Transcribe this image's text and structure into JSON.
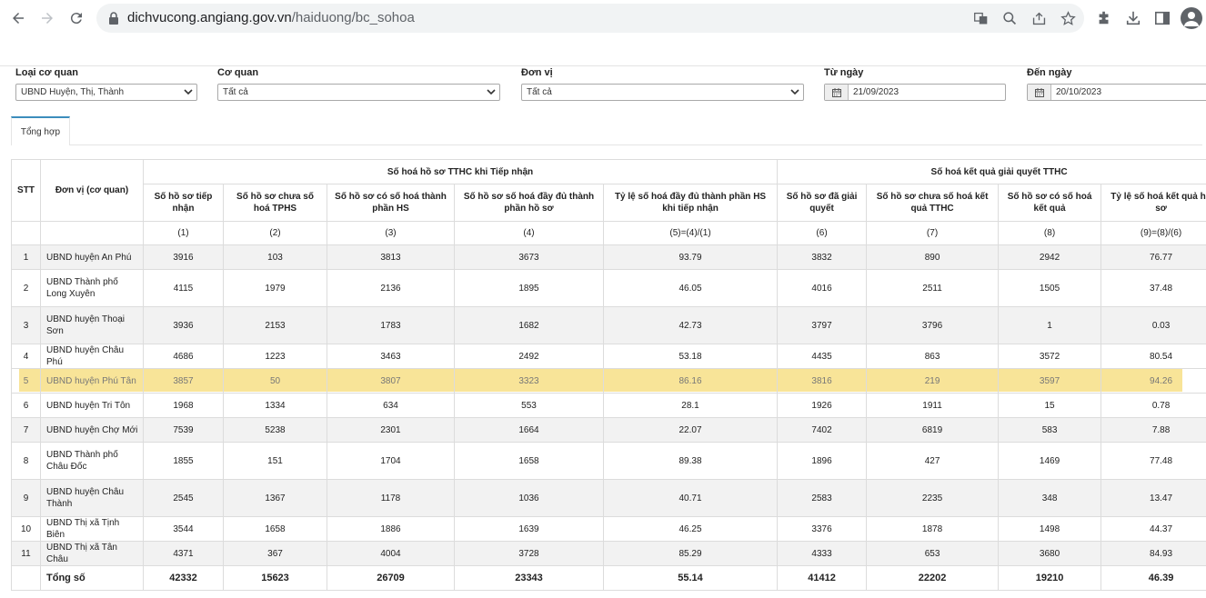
{
  "browser": {
    "url_host": "dichvucong.angiang.gov.vn",
    "url_path": "/haiduong/bc_sohoa"
  },
  "filters": {
    "loai_co_quan": {
      "label": "Loại cơ quan",
      "value": "UBND Huyện, Thị, Thành"
    },
    "co_quan": {
      "label": "Cơ quan",
      "value": "Tất cả"
    },
    "don_vi": {
      "label": "Đơn vị",
      "value": "Tất cả"
    },
    "tu_ngay": {
      "label": "Từ ngày",
      "value": "21/09/2023"
    },
    "den_ngay": {
      "label": "Đến ngày",
      "value": "20/10/2023"
    }
  },
  "tabs": [
    {
      "label": "Tổng hợp"
    }
  ],
  "table": {
    "head": {
      "stt": "STT",
      "unit": "Đơn vị (cơ quan)",
      "group1": "Số hoá hồ sơ TTHC khi Tiếp nhận",
      "group2": "Số hoá kết quả giải quyết TTHC",
      "cols": [
        "Số hồ sơ tiếp nhận",
        "Số hồ sơ chưa số hoá TPHS",
        "Số hồ sơ có số hoá thành phần HS",
        "Số hồ sơ số hoá đầy đủ thành phần hồ sơ",
        "Tỷ lệ số hoá đầy đủ thành phần HS khi tiếp nhận",
        "Số hồ sơ đã giải quyết",
        "Số hồ sơ chưa số hoá kết quả TTHC",
        "Số hồ sơ có số hoá kết quả",
        "Tỷ lệ số hoá kết quả hồ sơ"
      ],
      "formulas": [
        "(1)",
        "(2)",
        "(3)",
        "(4)",
        "(5)=(4)/(1)",
        "(6)",
        "(7)",
        "(8)",
        "(9)=(8)/(6)"
      ]
    },
    "rows": [
      {
        "stt": "1",
        "unit": "UBND huyện An Phú",
        "v": [
          "3916",
          "103",
          "3813",
          "3673",
          "93.79",
          "3832",
          "890",
          "2942",
          "76.77"
        ]
      },
      {
        "stt": "2",
        "unit": "UBND Thành phố Long Xuyên",
        "v": [
          "4115",
          "1979",
          "2136",
          "1895",
          "46.05",
          "4016",
          "2511",
          "1505",
          "37.48"
        ]
      },
      {
        "stt": "3",
        "unit": "UBND huyện Thoại Sơn",
        "v": [
          "3936",
          "2153",
          "1783",
          "1682",
          "42.73",
          "3797",
          "3796",
          "1",
          "0.03"
        ]
      },
      {
        "stt": "4",
        "unit": "UBND huyện Châu Phú",
        "v": [
          "4686",
          "1223",
          "3463",
          "2492",
          "53.18",
          "4435",
          "863",
          "3572",
          "80.54"
        ]
      },
      {
        "stt": "5",
        "unit": "UBND huyện Phú Tân",
        "v": [
          "3857",
          "50",
          "3807",
          "3323",
          "86.16",
          "3816",
          "219",
          "3597",
          "94.26"
        ]
      },
      {
        "stt": "6",
        "unit": "UBND huyện Tri Tôn",
        "v": [
          "1968",
          "1334",
          "634",
          "553",
          "28.1",
          "1926",
          "1911",
          "15",
          "0.78"
        ]
      },
      {
        "stt": "7",
        "unit": "UBND huyện Chợ Mới",
        "v": [
          "7539",
          "5238",
          "2301",
          "1664",
          "22.07",
          "7402",
          "6819",
          "583",
          "7.88"
        ]
      },
      {
        "stt": "8",
        "unit": "UBND Thành phố Châu Đốc",
        "v": [
          "1855",
          "151",
          "1704",
          "1658",
          "89.38",
          "1896",
          "427",
          "1469",
          "77.48"
        ]
      },
      {
        "stt": "9",
        "unit": "UBND huyện Châu Thành",
        "v": [
          "2545",
          "1367",
          "1178",
          "1036",
          "40.71",
          "2583",
          "2235",
          "348",
          "13.47"
        ]
      },
      {
        "stt": "10",
        "unit": "UBND Thị xã Tịnh Biên",
        "v": [
          "3544",
          "1658",
          "1886",
          "1639",
          "46.25",
          "3376",
          "1878",
          "1498",
          "44.37"
        ]
      },
      {
        "stt": "11",
        "unit": "UBND Thị xã Tân Châu",
        "v": [
          "4371",
          "367",
          "4004",
          "3728",
          "85.29",
          "4333",
          "653",
          "3680",
          "84.93"
        ]
      }
    ],
    "total": {
      "label": "Tổng số",
      "v": [
        "42332",
        "15623",
        "26709",
        "23343",
        "55.14",
        "41412",
        "22202",
        "19210",
        "46.39"
      ]
    }
  },
  "colors": {
    "highlight": "#f7e18d",
    "tab_accent": "#3c8dbc"
  }
}
